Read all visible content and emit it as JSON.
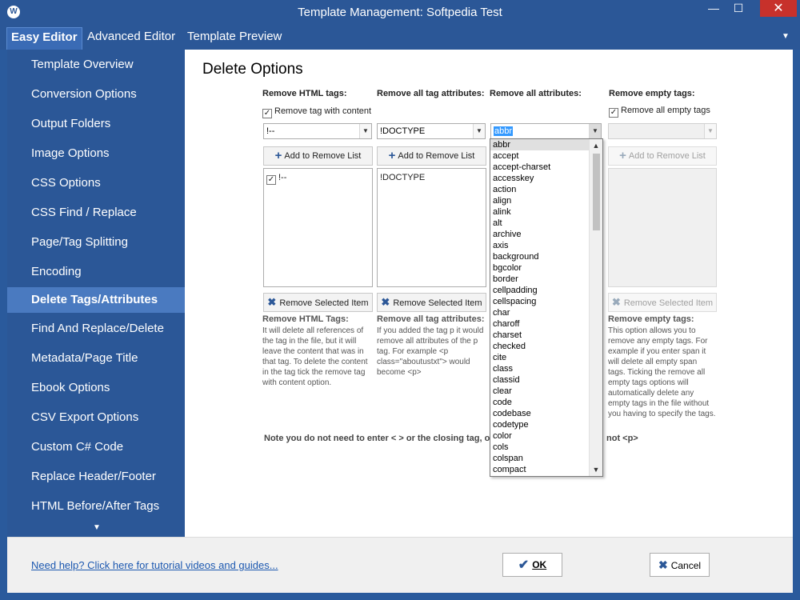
{
  "window": {
    "title": "Template Management: Softpedia Test",
    "minimize": "—",
    "maximize": "☐",
    "close": "✕",
    "app_icon": "W"
  },
  "menu": {
    "tabs": [
      "Easy Editor",
      "Advanced Editor",
      "Template Preview"
    ],
    "active": "Easy Editor",
    "arrow": "▼"
  },
  "sidebar": {
    "items": [
      "Template Overview",
      "Conversion Options",
      "Output Folders",
      "Image Options",
      "CSS Options",
      "CSS Find / Replace",
      "Page/Tag Splitting",
      "Encoding",
      "Delete Tags/Attributes",
      "Find And Replace/Delete",
      "Metadata/Page Title",
      "Ebook Options",
      "CSV Export Options",
      "Custom C# Code",
      "Replace Header/Footer",
      "HTML Before/After Tags"
    ],
    "active": "Delete Tags/Attributes",
    "scroll_down": "▼"
  },
  "main": {
    "heading": "Delete Options",
    "columns": {
      "html_tags": {
        "header": "Remove HTML tags:",
        "checkbox_label": "Remove tag with content",
        "checkbox_checked": true,
        "combo_value": "!--",
        "add_button": "Add to Remove List",
        "list_items": [
          {
            "label": "!--",
            "checked": true
          }
        ],
        "remove_button": "Remove Selected Item",
        "desc_title": "Remove HTML Tags:",
        "desc": "It will delete all references of the tag in the file, but it will leave the content that was in that tag. To delete the content in the tag tick the remove tag with content option."
      },
      "tag_attributes": {
        "header": "Remove all tag attributes:",
        "combo_value": "!DOCTYPE",
        "add_button": "Add to Remove List",
        "list_items": [
          "!DOCTYPE"
        ],
        "remove_button": "Remove Selected Item",
        "desc_title": "Remove all tag attributes:",
        "desc": "If you added the tag p it would remove all attributes of the p tag. For example <p class=\"aboutustxt\"> would become <p>"
      },
      "all_attributes": {
        "header": "Remove all attributes:",
        "combo_value": "abbr"
      },
      "empty_tags": {
        "header": "Remove empty tags:",
        "checkbox_label": "Remove all empty tags",
        "checkbox_checked": true,
        "combo_value": "",
        "add_button": "Add to Remove List",
        "remove_button": "Remove Selected Item",
        "desc_title": "Remove empty tags:",
        "desc": "This option allows you to remove any empty tags. For example if you enter span it will delete all empty span tags. Ticking the remove all empty tags options will automatically delete any empty tags in the file without you having to specify the tags."
      }
    },
    "note_left": "Note you do not need to enter < > or the closing tag, o",
    "note_right": "not <p>",
    "dropdown": {
      "items": [
        "abbr",
        "accept",
        "accept-charset",
        "accesskey",
        "action",
        "align",
        "alink",
        "alt",
        "archive",
        "axis",
        "background",
        "bgcolor",
        "border",
        "cellpadding",
        "cellspacing",
        "char",
        "charoff",
        "charset",
        "checked",
        "cite",
        "class",
        "classid",
        "clear",
        "code",
        "codebase",
        "codetype",
        "color",
        "cols",
        "colspan",
        "compact"
      ],
      "highlighted": "abbr",
      "scroll_up": "▲",
      "scroll_down": "▼"
    }
  },
  "footer": {
    "help_link": "Need help? Click here for tutorial videos and guides...",
    "ok_label": "OK",
    "cancel_label": "Cancel"
  },
  "colors": {
    "brand_blue": "#2b5797",
    "sidebar_active": "#4a7ac0",
    "close_red": "#c7312b",
    "link_blue": "#1c58b0"
  }
}
